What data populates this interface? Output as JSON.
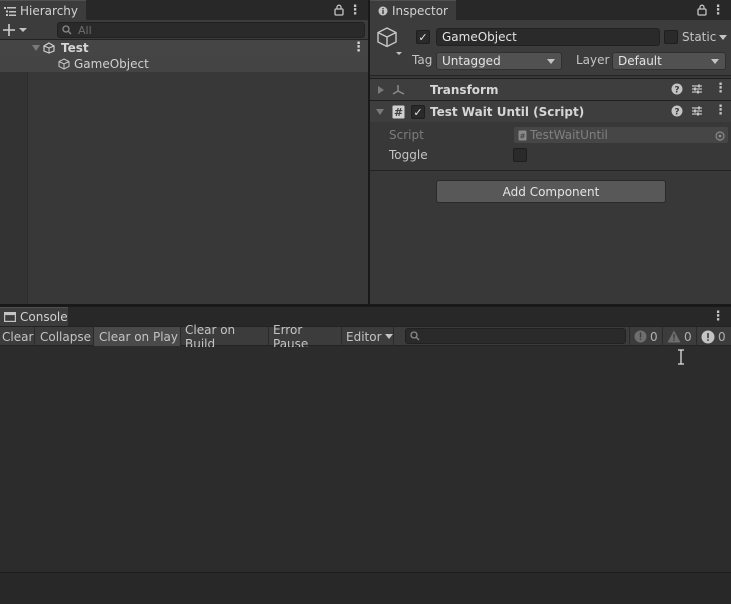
{
  "hierarchy": {
    "tab_label": "Hierarchy",
    "search_placeholder": "All",
    "scene_name": "Test",
    "items": [
      {
        "label": "GameObject"
      }
    ]
  },
  "inspector": {
    "tab_label": "Inspector",
    "object_name": "GameObject",
    "static_label": "Static",
    "tag_label": "Tag",
    "tag_value": "Untagged",
    "layer_label": "Layer",
    "layer_value": "Default",
    "components": [
      {
        "title": "Transform"
      },
      {
        "title": "Test Wait Until (Script)"
      }
    ],
    "script_label": "Script",
    "script_value": "TestWaitUntil",
    "toggle_label": "Toggle",
    "add_component_label": "Add Component"
  },
  "console": {
    "tab_label": "Console",
    "buttons": [
      "Clear",
      "Collapse",
      "Clear on Play",
      "Clear on Build",
      "Error Pause",
      "Editor"
    ],
    "active_button": "Clear on Play",
    "counts": {
      "log": "0",
      "warning": "0",
      "error": "0"
    }
  },
  "colors": {
    "background": "#191919",
    "panel": "#383838",
    "field": "#515151",
    "dark_field": "#2a2a2a",
    "text": "#c4c4c4"
  }
}
